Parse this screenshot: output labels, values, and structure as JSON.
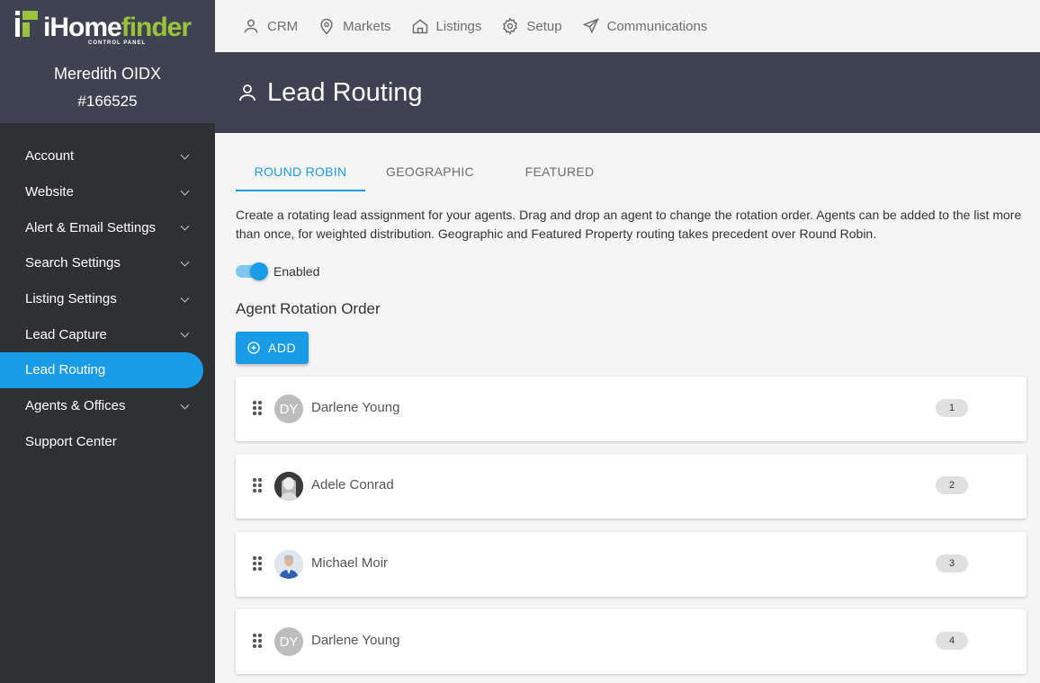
{
  "brand": {
    "logo_i": "i",
    "logo_home": "Home",
    "logo_finder": "finder",
    "logo_sub": "CONTROL PANEL",
    "account_name": "Meredith OIDX",
    "account_number": "#166525"
  },
  "sidebar": {
    "items": [
      {
        "label": "Account",
        "expandable": true
      },
      {
        "label": "Website",
        "expandable": true
      },
      {
        "label": "Alert & Email Settings",
        "expandable": true
      },
      {
        "label": "Search Settings",
        "expandable": true
      },
      {
        "label": "Listing Settings",
        "expandable": true
      },
      {
        "label": "Lead Capture",
        "expandable": true
      },
      {
        "label": "Lead Routing",
        "expandable": false,
        "active": true
      },
      {
        "label": "Agents & Offices",
        "expandable": true
      },
      {
        "label": "Support Center",
        "expandable": false
      }
    ]
  },
  "topnav": {
    "items": [
      {
        "label": "CRM",
        "icon": "person-icon"
      },
      {
        "label": "Markets",
        "icon": "map-pin-icon"
      },
      {
        "label": "Listings",
        "icon": "house-icon"
      },
      {
        "label": "Setup",
        "icon": "gear-icon"
      },
      {
        "label": "Communications",
        "icon": "send-icon"
      }
    ]
  },
  "header": {
    "title": "Lead Routing",
    "icon": "person-icon"
  },
  "tabs": [
    {
      "label": "ROUND ROBIN",
      "active": true
    },
    {
      "label": "GEOGRAPHIC",
      "active": false
    },
    {
      "label": "FEATURED",
      "active": false
    }
  ],
  "description": "Create a rotating lead assignment for your agents. Drag and drop an agent to change the rotation order. Agents can be added to the list more than once, for weighted distribution. Geographic and Featured Property routing takes precedent over Round Robin.",
  "toggle": {
    "label": "Enabled",
    "on": true
  },
  "section_title": "Agent Rotation Order",
  "add_button": "ADD",
  "agents": [
    {
      "name": "Darlene Young",
      "initials": "DY",
      "rank": "1",
      "photo": false
    },
    {
      "name": "Adele Conrad",
      "initials": "",
      "rank": "2",
      "photo": true
    },
    {
      "name": "Michael Moir",
      "initials": "",
      "rank": "3",
      "photo": true
    },
    {
      "name": "Darlene Young",
      "initials": "DY",
      "rank": "4",
      "photo": false
    }
  ],
  "colors": {
    "accent": "#1a9be6",
    "sidebar_bg": "#2f3033",
    "header_bg": "#3e4251",
    "brand_green": "#9bc23c"
  }
}
